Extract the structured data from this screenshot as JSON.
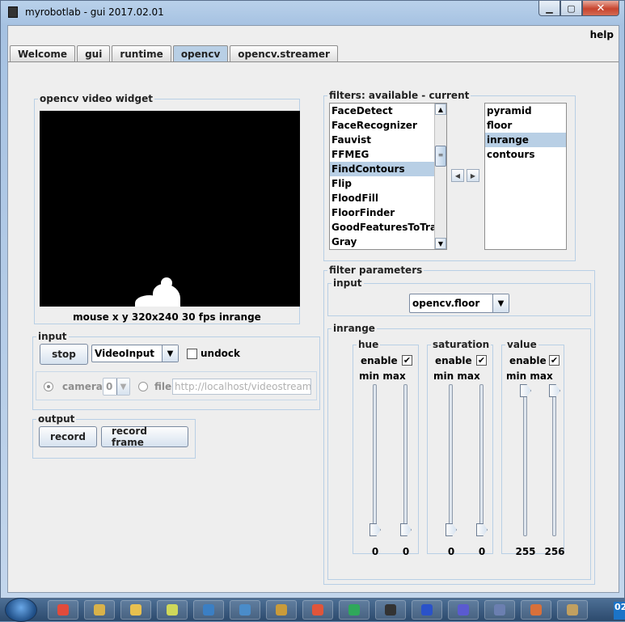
{
  "window": {
    "title": "myrobotlab - gui 2017.02.01"
  },
  "menu": {
    "help": "help"
  },
  "tabs": [
    "Welcome",
    "gui",
    "runtime",
    "opencv",
    "opencv.streamer"
  ],
  "video_widget": {
    "legend": "opencv  video widget",
    "status": "mouse x y  320x240  30 fps  inrange"
  },
  "input_panel": {
    "legend": "input",
    "stop_label": "stop",
    "source_value": "VideoInput",
    "undock_label": "undock",
    "camera_label": "camera",
    "camera_index": "0",
    "file_label": "file",
    "file_value": "http://localhost/videostream.cgi"
  },
  "output_panel": {
    "legend": "output",
    "record_label": "record",
    "record_frame_label": "record frame"
  },
  "filters": {
    "legend": "filters: available - current",
    "available": [
      "FaceDetect",
      "FaceRecognizer",
      "Fauvist",
      "FFMEG",
      "FindContours",
      "Flip",
      "FloodFill",
      "FloorFinder",
      "GoodFeaturesToTrack",
      "Gray"
    ],
    "available_selected": "FindContours",
    "current": [
      "pyramid",
      "floor",
      "inrange",
      "contours"
    ],
    "current_selected": "inrange"
  },
  "filter_parameters": {
    "legend": "filter parameters",
    "input_legend": "input",
    "input_value": "opencv.floor",
    "inrange_legend": "inrange",
    "enable_label": "enable",
    "minmax_label": "min max",
    "channels": [
      {
        "name": "hue",
        "enabled": "✔",
        "min": "0",
        "max": "0",
        "min_frac": 0.0,
        "max_frac": 0.0
      },
      {
        "name": "saturation",
        "enabled": "✔",
        "min": "0",
        "max": "0",
        "min_frac": 0.0,
        "max_frac": 0.0
      },
      {
        "name": "value",
        "enabled": "✔",
        "min": "255",
        "max": "256",
        "min_frac": 1.0,
        "max_frac": 1.0
      }
    ]
  },
  "taskbar": {
    "icons": [
      "chrome-icon",
      "files-icon",
      "explorer-icon",
      "notepad-icon",
      "window-icon",
      "console-icon",
      "network-icon",
      "recorder-icon",
      "hangouts-icon",
      "terminal-icon",
      "binoculars-icon",
      "globe-icon",
      "vlc-icon",
      "settings-icon",
      "paint-icon"
    ],
    "clock_fragment": "02"
  }
}
